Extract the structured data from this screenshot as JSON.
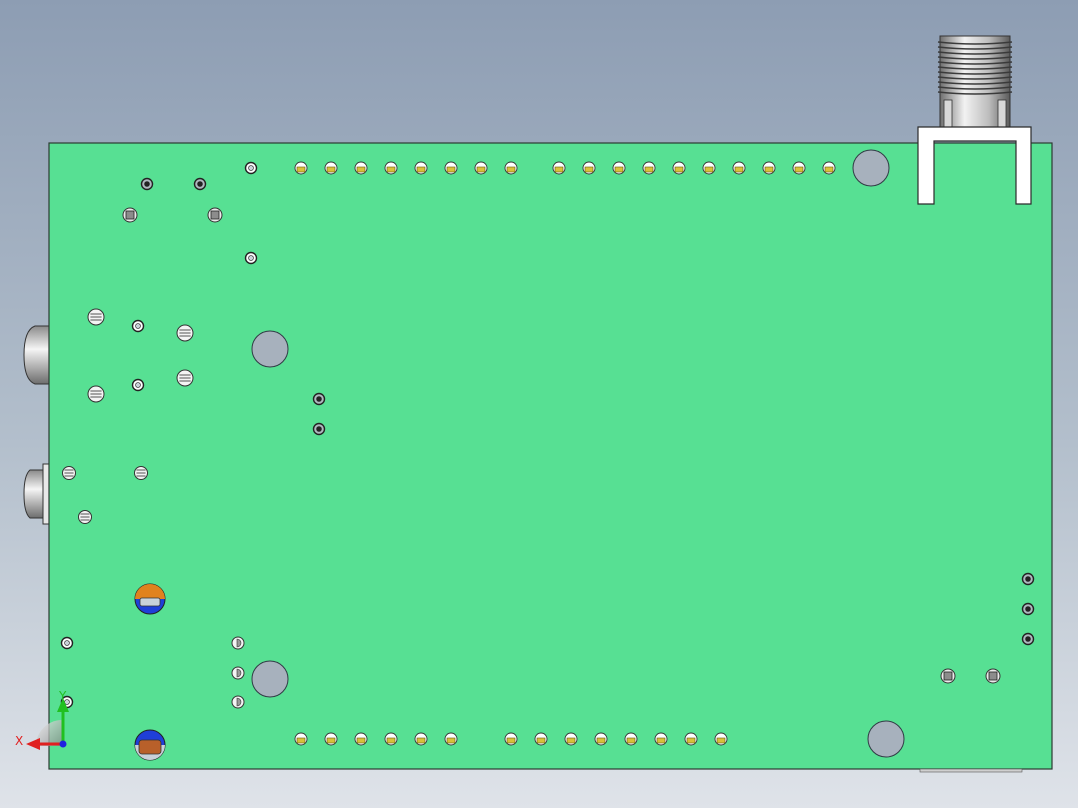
{
  "scene": {
    "board_color": "#57e093",
    "board_edge_color": "#2c3a31",
    "hole_color": "#a7b1bd",
    "pad_color": "#d8c23a",
    "cap_top_color": "#e0821d",
    "cap_bottom_color": "#1f3fd8",
    "cap_body_color": "#b8602a"
  },
  "triad": {
    "x_label": "X",
    "y_label": "Y",
    "x_color": "#e02020",
    "y_color": "#20c020",
    "z_color": "#2020e0"
  }
}
